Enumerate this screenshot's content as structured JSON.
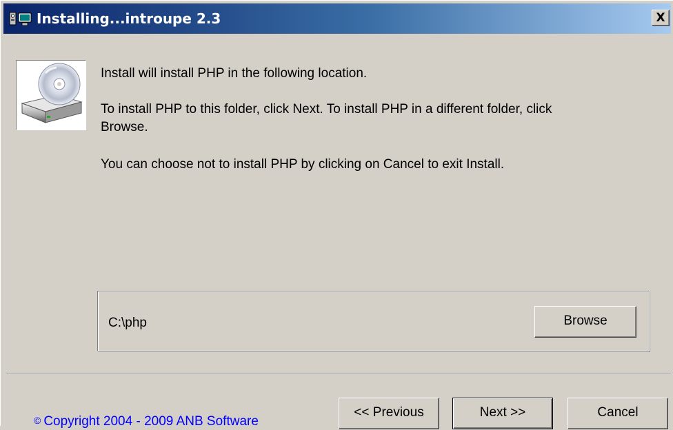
{
  "window": {
    "title": "Installing...introupe 2.3",
    "close_label": "X",
    "title_icon": "installer-computer-icon"
  },
  "content": {
    "icon": "cd-drive-icon",
    "line1": "Install will install PHP in the following location.",
    "line2a": "To install PHP to this folder, click Next. To install PHP in a different folder, click",
    "line2b": "Browse.",
    "line3": "You can choose not to install PHP by clicking on Cancel to exit Install."
  },
  "destination": {
    "path": "C:\\php",
    "browse_label": "Browse"
  },
  "footer": {
    "copyright": "Copyright 2004 - 2009 ANB Software",
    "copyright_symbol": "©",
    "copyright_color": "#0000ff",
    "previous_label": "<< Previous",
    "next_label": "Next >>",
    "cancel_label": "Cancel"
  },
  "colors": {
    "titlebar_start": "#0a246a",
    "titlebar_end": "#a6caf0",
    "face": "#d4d0c8"
  }
}
